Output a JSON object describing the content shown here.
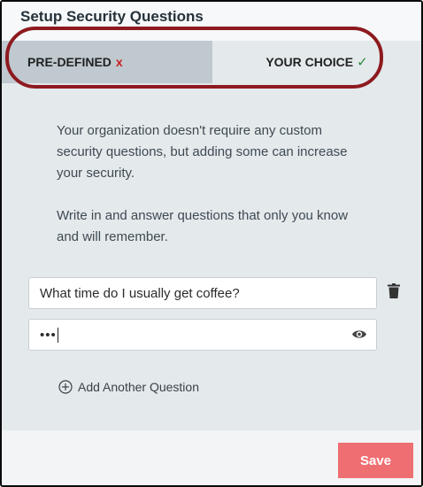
{
  "header": {
    "title": "Setup Security Questions"
  },
  "tabs": [
    {
      "label": "PRE-DEFINED",
      "status_glyph": "x"
    },
    {
      "label": "YOUR CHOICE",
      "status_glyph": "✓"
    }
  ],
  "description": {
    "paragraph1": "Your organization doesn't require any custom security questions, but adding some can increase your security.",
    "paragraph2": "Write in and answer questions that only you know and will remember."
  },
  "form": {
    "question_value": "What time do I usually get coffee?",
    "answer_masked": "•••"
  },
  "add_question_label": "Add Another Question",
  "footer": {
    "save_label": "Save"
  },
  "colors": {
    "highlight_ring": "#8d1a1f",
    "error_x": "#cc1f1f",
    "check": "#2c8a3b",
    "save_button": "#ef6e72"
  }
}
